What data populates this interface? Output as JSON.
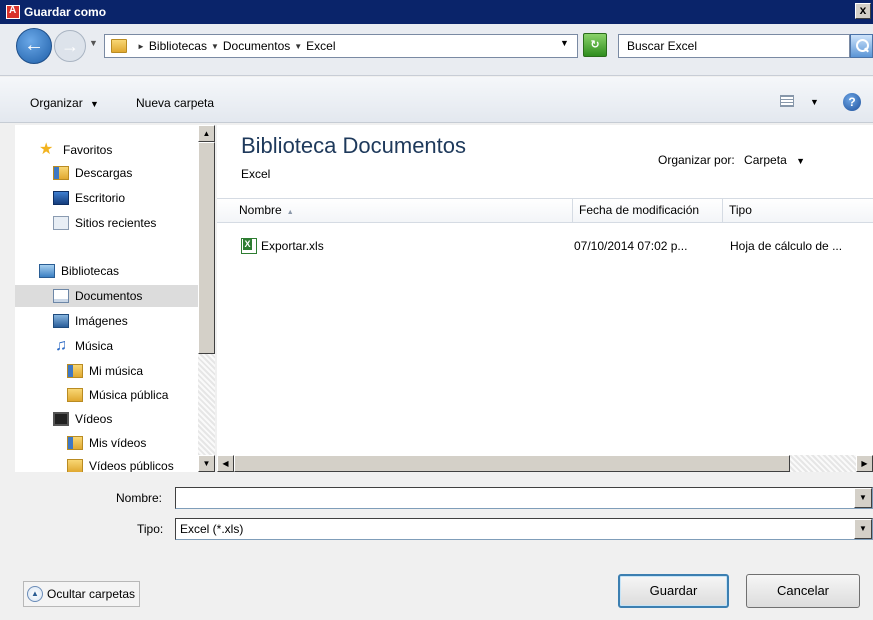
{
  "window": {
    "title": "Guardar como",
    "close_label": "x"
  },
  "address": {
    "crumbs": [
      "Bibliotecas",
      "Documentos",
      "Excel"
    ],
    "search_placeholder": "Buscar Excel"
  },
  "toolbar": {
    "organize": "Organizar",
    "new_folder": "Nueva carpeta",
    "help": "?"
  },
  "nav": {
    "favorites": "Favoritos",
    "downloads": "Descargas",
    "desktop": "Escritorio",
    "recent": "Sitios recientes",
    "libraries": "Bibliotecas",
    "documents": "Documentos",
    "images": "Imágenes",
    "music": "Música",
    "my_music": "Mi música",
    "public_music": "Música pública",
    "videos": "Vídeos",
    "my_videos": "Mis vídeos",
    "public_videos": "Vídeos públicos"
  },
  "content": {
    "library_title": "Biblioteca Documentos",
    "library_subtitle": "Excel",
    "arrange_label": "Organizar por:",
    "arrange_value": "Carpeta",
    "columns": {
      "name": "Nombre",
      "modified": "Fecha de modificación",
      "type": "Tipo"
    },
    "files": [
      {
        "name": "Exportar.xls",
        "modified": "07/10/2014 07:02 p...",
        "type": "Hoja de cálculo de ..."
      }
    ]
  },
  "form": {
    "filename_label": "Nombre:",
    "filename_value": "",
    "type_label": "Tipo:",
    "type_value": "Excel (*.xls)"
  },
  "buttons": {
    "hide_folders": "Ocultar carpetas",
    "save": "Guardar",
    "cancel": "Cancelar"
  },
  "colors": {
    "titlebar": "#0a246a",
    "library_title": "#1e395b",
    "selected_row": "#dcdcdc"
  }
}
